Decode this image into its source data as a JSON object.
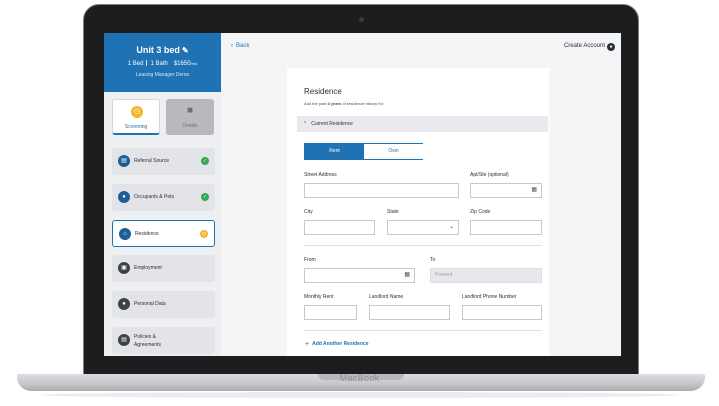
{
  "device": {
    "brand": "MacBook"
  },
  "unit": {
    "title": "Unit 3 bed",
    "beds": "1 Bed",
    "baths": "1 Bath",
    "price": "$1650",
    "price_period": "/mo",
    "manager": "Leasing Manager Demo"
  },
  "tabs": [
    {
      "label": "Screening",
      "icon": "clock-icon",
      "active": true
    },
    {
      "label": "Details",
      "icon": "lock-icon",
      "active": false
    }
  ],
  "nav": {
    "items": [
      {
        "label": "Referral Source",
        "icon": "chat-icon",
        "status": "complete"
      },
      {
        "label": "Occupants & Pets",
        "icon": "people-icon",
        "status": "complete"
      },
      {
        "label": "Residence",
        "icon": "home-icon",
        "status": "in-progress"
      },
      {
        "label": "Employment",
        "icon": "briefcase-icon",
        "status": "none"
      },
      {
        "label": "Personal Data",
        "icon": "person-icon",
        "status": "none"
      },
      {
        "label_line1": "Policies &",
        "label_line2": "Agreements",
        "icon": "document-icon",
        "status": "none"
      }
    ]
  },
  "header": {
    "back_label": "Back",
    "create_account_label": "Create Account"
  },
  "form": {
    "title": "Residence",
    "subtitle_pre": "Add the past ",
    "subtitle_bold": "3 years",
    "subtitle_post": " of residence history for:",
    "section_label": "Current Residence",
    "toggle": {
      "options": [
        "Rent",
        "Own"
      ],
      "selected": "Rent"
    },
    "fields": {
      "street_address": {
        "label": "Street Address",
        "value": ""
      },
      "apt_suite": {
        "label": "Apt/Ste (optional)",
        "value": ""
      },
      "city": {
        "label": "City",
        "value": ""
      },
      "state": {
        "label": "State",
        "value": ""
      },
      "zip": {
        "label": "Zip Code",
        "value": ""
      },
      "from": {
        "label": "From",
        "value": ""
      },
      "to": {
        "label": "To",
        "value": "Present"
      },
      "monthly_rent": {
        "label": "Monthly Rent",
        "value": ""
      },
      "landlord_name": {
        "label": "Landlord Name",
        "value": ""
      },
      "landlord_phone": {
        "label": "Landlord Phone Number",
        "value": ""
      }
    },
    "add_another_label": "Add Another Residence"
  },
  "colors": {
    "primary": "#1f72b4",
    "complete": "#34a853",
    "in_progress": "#f3b52a"
  }
}
